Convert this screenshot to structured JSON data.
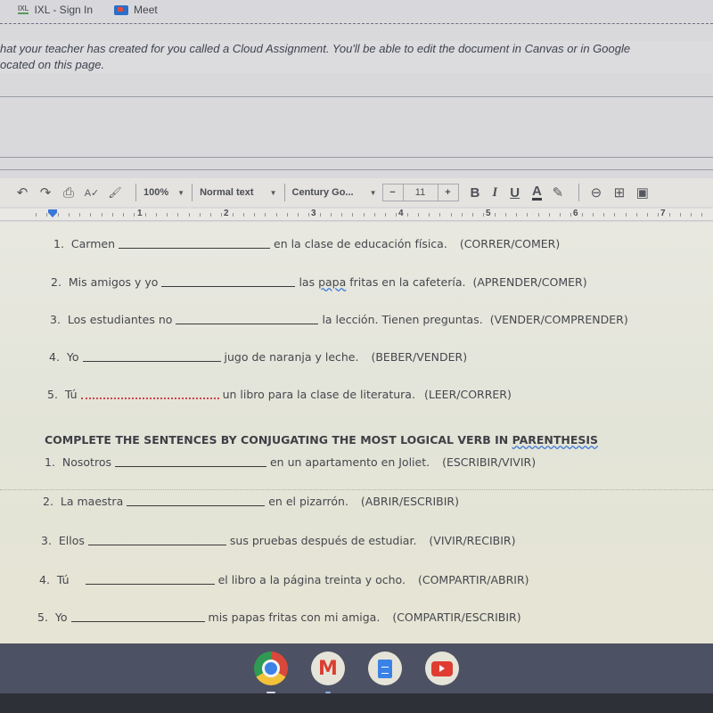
{
  "bookmarks": [
    {
      "icon": "ixl-icon",
      "logo_text": "IXL",
      "label": "IXL - Sign In"
    },
    {
      "icon": "meet-icon",
      "label": "Meet"
    }
  ],
  "notice": {
    "line1": "hat your teacher has created for you called a Cloud Assignment. You'll be able to edit the document in Canvas or in Google",
    "line2": "ocated on this page."
  },
  "toolbar": {
    "icons": [
      "undo-icon",
      "redo-icon",
      "print-icon",
      "spellcheck-icon",
      "paint-format-icon"
    ],
    "undo_glyph": "↶",
    "redo_glyph": "↷",
    "print_glyph": "⎙",
    "spell_glyph": "A✓",
    "paint_glyph": "🖌",
    "zoom": "100%",
    "style": "Normal text",
    "font": "Century Go...",
    "font_size": "11",
    "minus": "−",
    "plus": "+",
    "bold": "B",
    "italic": "I",
    "underline": "U",
    "text_color": "A",
    "highlight_glyph": "✎",
    "link_glyph": "⊖",
    "comment_glyph": "⊞",
    "image_glyph": "▣"
  },
  "ruler": {
    "numbers": [
      "1",
      "2",
      "3",
      "4",
      "5",
      "6",
      "7"
    ]
  },
  "exercise1": [
    {
      "num": "1.",
      "subject": "Carmen",
      "rest": "en la clase de educación física.",
      "verbs": "(CORRER/COMER)"
    },
    {
      "num": "2.",
      "subject": "Mis amigos y yo",
      "rest_pre": "las ",
      "rest_flag": "papa",
      "rest_post": " fritas en la cafetería.",
      "verbs": "(APRENDER/COMER)"
    },
    {
      "num": "3.",
      "subject": "Los estudiantes no",
      "rest": "la lección.  Tienen preguntas.",
      "verbs": "(VENDER/COMPRENDER)"
    },
    {
      "num": "4.",
      "subject": "Yo",
      "rest": "jugo de naranja y leche.",
      "verbs": "(BEBER/VENDER)"
    },
    {
      "num": "5.",
      "subject": "Tú",
      "rest": "un libro para la clase de literatura.",
      "verbs": "(LEER/CORRER)"
    }
  ],
  "section_title": {
    "pre": "COMPLETE THE SENTENCES BY CONJUGATING THE MOST LOGICAL VERB IN ",
    "flag": "PARENTHESIS"
  },
  "exercise2": [
    {
      "num": "1.",
      "subject": "Nosotros",
      "rest": "en un apartamento en Joliet.",
      "verbs": "(ESCRIBIR/VIVIR)"
    },
    {
      "num": "2.",
      "subject": "La maestra",
      "rest": "en el pizarrón.",
      "verbs": "(ABRIR/ESCRIBIR)"
    },
    {
      "num": "3.",
      "subject": "Ellos",
      "rest": "sus pruebas después de estudiar.",
      "verbs": "(VIVIR/RECIBIR)"
    },
    {
      "num": "4.",
      "subject": "Tú",
      "rest": "el libro a la página treinta y ocho.",
      "verbs": "(COMPARTIR/ABRIR)"
    },
    {
      "num": "5.",
      "subject": "Yo",
      "rest": "mis papas fritas con mi amiga.",
      "verbs": "(COMPARTIR/ESCRIBIR)"
    }
  ],
  "shelf": {
    "apps": [
      "chrome",
      "gmail",
      "google-docs",
      "youtube"
    ],
    "gmail_glyph": "M"
  }
}
